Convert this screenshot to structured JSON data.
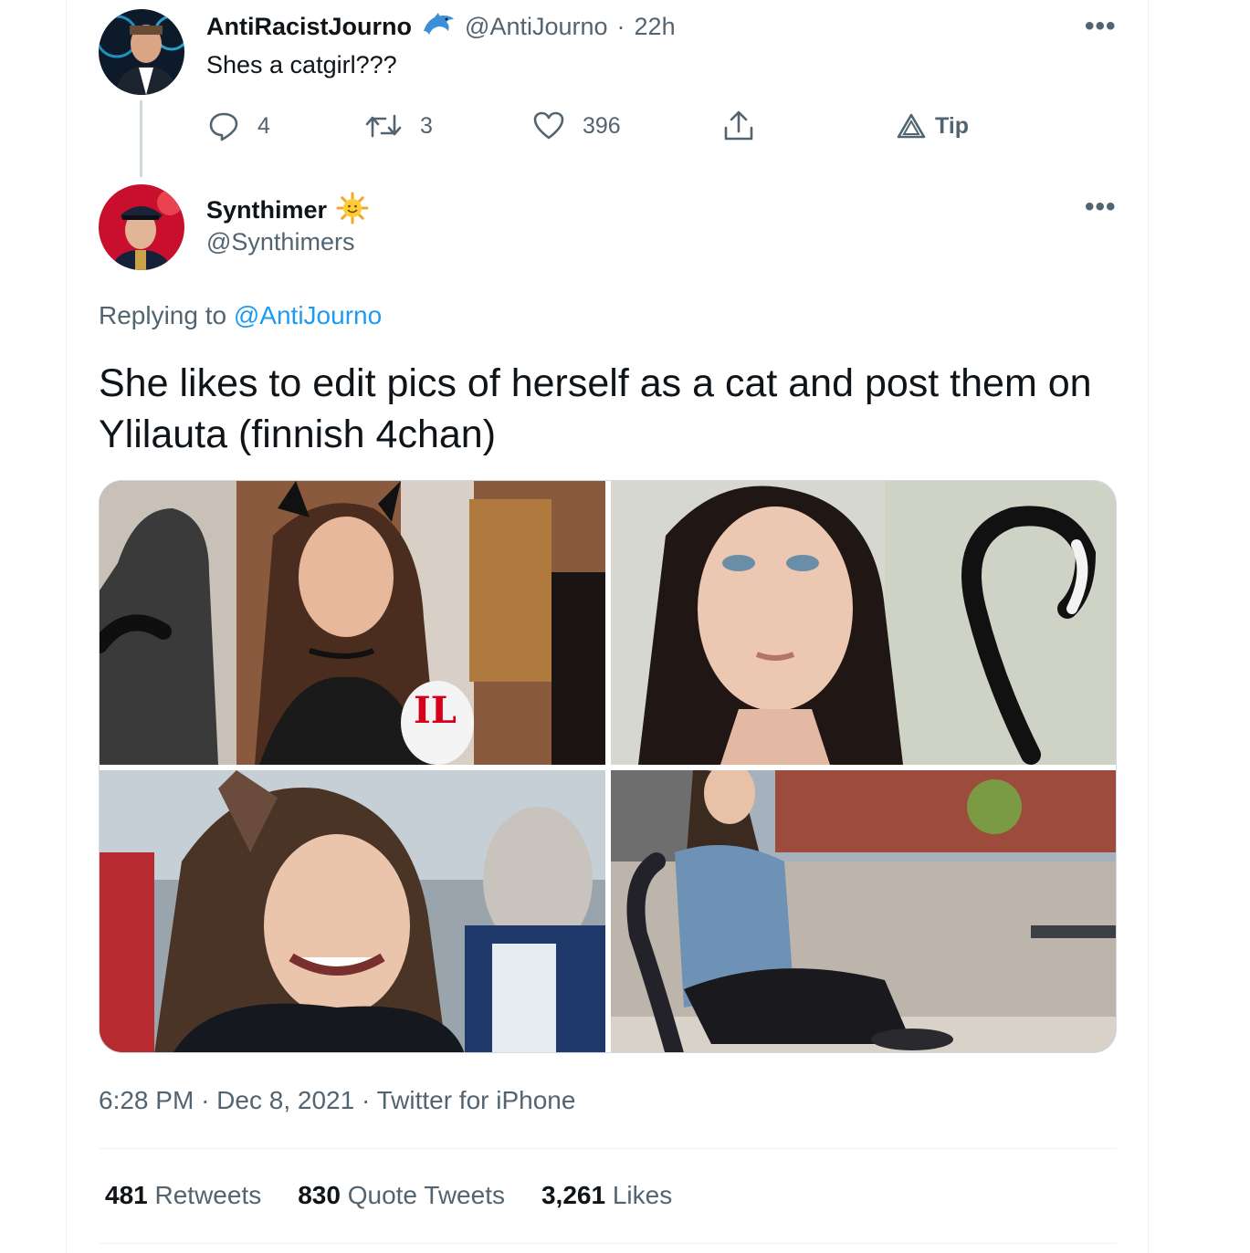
{
  "parent_tweet": {
    "display_name": "AntiRacistJourno",
    "badge_icon": "dolphin-icon",
    "handle": "@AntiJourno",
    "separator": "·",
    "time": "22h",
    "text": "Shes a catgirl???",
    "replies": "4",
    "retweets": "3",
    "likes": "396",
    "tip_label": "Tip"
  },
  "reply_tweet": {
    "display_name": "Synthimer",
    "badge_icon": "sun-emoji-icon",
    "handle": "@Synthimers",
    "replying_prefix": "Replying to",
    "replying_handle": "@AntiJourno",
    "text": "She likes to edit pics of herself as a cat and post them on Ylilauta (finnish 4chan)",
    "microphone_label": "IL",
    "timestamp": "6:28 PM",
    "date": "Dec 8, 2021",
    "source": "Twitter for iPhone",
    "separator": "·"
  },
  "stats": {
    "retweets_count": "481",
    "retweets_label": "Retweets",
    "quote_count": "830",
    "quote_label": "Quote Tweets",
    "likes_count": "3,261",
    "likes_label": "Likes"
  },
  "colors": {
    "text": "#0f1419",
    "muted": "#536471",
    "link": "#1d9bf0",
    "border": "#eff3f4"
  }
}
